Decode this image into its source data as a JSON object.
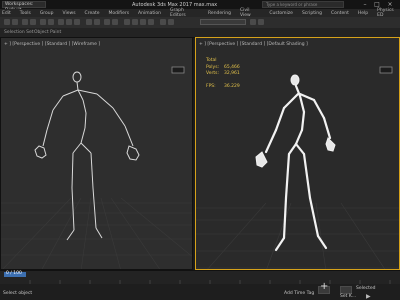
{
  "titlebar": {
    "workspace": "Workspaces: Default",
    "title": "Autodesk 3ds Max 2017     max.max",
    "search_placeholder": "Type a keyword or phrase",
    "min": "–",
    "max": "□",
    "close": "×"
  },
  "menu": [
    "Edit",
    "Tools",
    "Group",
    "Views",
    "Create",
    "Modifiers",
    "Animation",
    "Graph Editors",
    "Rendering",
    "Civil View",
    "Customize",
    "Scripting",
    "Content",
    "Help",
    "Physics ED"
  ],
  "ribbon_tabs": [
    "Selection Set",
    "Object Paint"
  ],
  "viewports": {
    "left": {
      "label": "+ ] [Perspective ] [Standard ] [Wireframe ]"
    },
    "right": {
      "label": "+ ] [Perspective ] [Standard ] [Default Shading ]",
      "stats": {
        "header": "Total",
        "polys_label": "Polys:",
        "polys": "65,466",
        "verts_label": "Verts:",
        "verts": "32,961",
        "fps_label": "FPS:",
        "fps": "36.229"
      }
    }
  },
  "timeline": {
    "frame_label": "0 / 100"
  },
  "status": {
    "prompt": "Select object",
    "add_time_tag": "Add Time Tag",
    "selected_label": "Selected",
    "set_key": "Set K..."
  },
  "colors": {
    "active_viewport": "#d6a21a",
    "timeline_marker": "#3c6fb0"
  }
}
